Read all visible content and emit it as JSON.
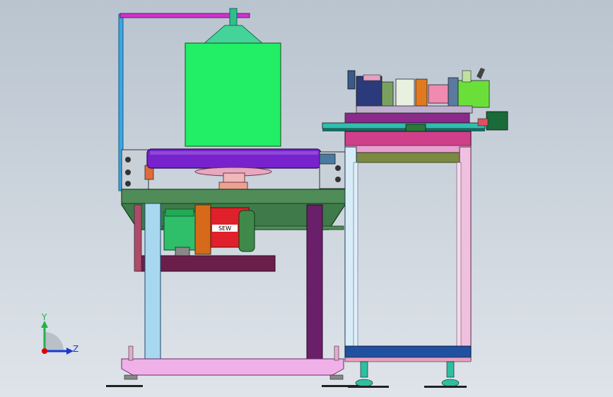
{
  "view": {
    "background_top": "#b9c4cf",
    "background_bottom": "#dfe4ea"
  },
  "triad": {
    "y_label": "Y",
    "z_label": "Z",
    "y_color": "#22b14c",
    "z_color": "#1a3ad0",
    "origin_color": "#e00000"
  },
  "motor_panel": {
    "text": "SEW"
  },
  "colors": {
    "hopper_box": "#22ee66",
    "hopper_cone": "#44d49a",
    "frame_rod": "#3aa7e0",
    "top_bar": "#cc33cc",
    "roller": "#7722cc",
    "table": "#3f7a4a",
    "legs_light": "#a8d8f0",
    "leg_dark": "#6a1f6a",
    "base_plate": "#f0b0e8",
    "motor_red": "#e0202a",
    "motor_green": "#2fbf6a",
    "gear_orange": "#d66a1a",
    "right_frame_pink": "#f0c0e0",
    "right_frame_blue": "#2050a0",
    "right_frame_olive": "#7a8a40"
  }
}
